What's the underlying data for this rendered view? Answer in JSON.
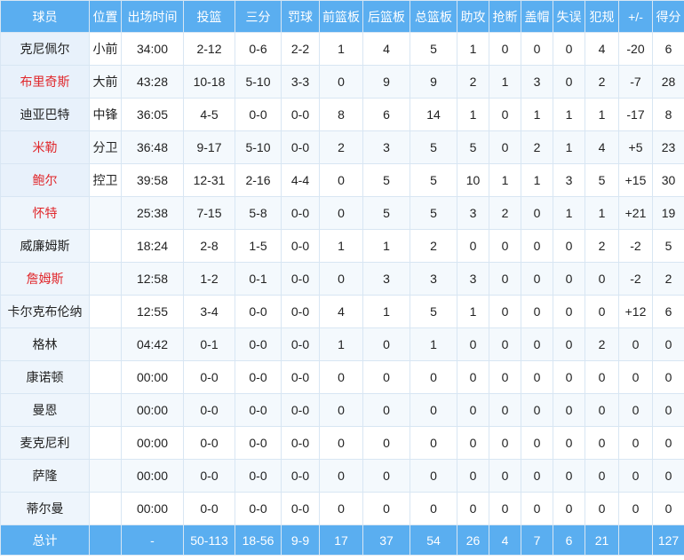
{
  "headers": [
    "球员",
    "位置",
    "出场时间",
    "投篮",
    "三分",
    "罚球",
    "前篮板",
    "后篮板",
    "总篮板",
    "助攻",
    "抢断",
    "盖帽",
    "失误",
    "犯规",
    "+/-",
    "得分"
  ],
  "players": [
    {
      "name": "克尼佩尔",
      "pos": "小前",
      "min": "34:00",
      "fg": "2-12",
      "tp": "0-6",
      "ft": "2-2",
      "oreb": "1",
      "dreb": "4",
      "reb": "5",
      "ast": "1",
      "stl": "0",
      "blk": "0",
      "tov": "0",
      "pf": "4",
      "pm": "-20",
      "pts": "6",
      "highlight": false
    },
    {
      "name": "布里奇斯",
      "pos": "大前",
      "min": "43:28",
      "fg": "10-18",
      "tp": "5-10",
      "ft": "3-3",
      "oreb": "0",
      "dreb": "9",
      "reb": "9",
      "ast": "2",
      "stl": "1",
      "blk": "3",
      "tov": "0",
      "pf": "2",
      "pm": "-7",
      "pts": "28",
      "highlight": true
    },
    {
      "name": "迪亚巴特",
      "pos": "中锋",
      "min": "36:05",
      "fg": "4-5",
      "tp": "0-0",
      "ft": "0-0",
      "oreb": "8",
      "dreb": "6",
      "reb": "14",
      "ast": "1",
      "stl": "0",
      "blk": "1",
      "tov": "1",
      "pf": "1",
      "pm": "-17",
      "pts": "8",
      "highlight": false
    },
    {
      "name": "米勒",
      "pos": "分卫",
      "min": "36:48",
      "fg": "9-17",
      "tp": "5-10",
      "ft": "0-0",
      "oreb": "2",
      "dreb": "3",
      "reb": "5",
      "ast": "5",
      "stl": "0",
      "blk": "2",
      "tov": "1",
      "pf": "4",
      "pm": "+5",
      "pts": "23",
      "highlight": true
    },
    {
      "name": "鲍尔",
      "pos": "控卫",
      "min": "39:58",
      "fg": "12-31",
      "tp": "2-16",
      "ft": "4-4",
      "oreb": "0",
      "dreb": "5",
      "reb": "5",
      "ast": "10",
      "stl": "1",
      "blk": "1",
      "tov": "3",
      "pf": "5",
      "pm": "+15",
      "pts": "30",
      "highlight": true
    },
    {
      "name": "怀特",
      "pos": "",
      "min": "25:38",
      "fg": "7-15",
      "tp": "5-8",
      "ft": "0-0",
      "oreb": "0",
      "dreb": "5",
      "reb": "5",
      "ast": "3",
      "stl": "2",
      "blk": "0",
      "tov": "1",
      "pf": "1",
      "pm": "+21",
      "pts": "19",
      "highlight": true
    },
    {
      "name": "威廉姆斯",
      "pos": "",
      "min": "18:24",
      "fg": "2-8",
      "tp": "1-5",
      "ft": "0-0",
      "oreb": "1",
      "dreb": "1",
      "reb": "2",
      "ast": "0",
      "stl": "0",
      "blk": "0",
      "tov": "0",
      "pf": "2",
      "pm": "-2",
      "pts": "5",
      "highlight": false
    },
    {
      "name": "詹姆斯",
      "pos": "",
      "min": "12:58",
      "fg": "1-2",
      "tp": "0-1",
      "ft": "0-0",
      "oreb": "0",
      "dreb": "3",
      "reb": "3",
      "ast": "3",
      "stl": "0",
      "blk": "0",
      "tov": "0",
      "pf": "0",
      "pm": "-2",
      "pts": "2",
      "highlight": true
    },
    {
      "name": "卡尔克布伦纳",
      "pos": "",
      "min": "12:55",
      "fg": "3-4",
      "tp": "0-0",
      "ft": "0-0",
      "oreb": "4",
      "dreb": "1",
      "reb": "5",
      "ast": "1",
      "stl": "0",
      "blk": "0",
      "tov": "0",
      "pf": "0",
      "pm": "+12",
      "pts": "6",
      "highlight": false
    },
    {
      "name": "格林",
      "pos": "",
      "min": "04:42",
      "fg": "0-1",
      "tp": "0-0",
      "ft": "0-0",
      "oreb": "1",
      "dreb": "0",
      "reb": "1",
      "ast": "0",
      "stl": "0",
      "blk": "0",
      "tov": "0",
      "pf": "2",
      "pm": "0",
      "pts": "0",
      "highlight": false
    },
    {
      "name": "康诺顿",
      "pos": "",
      "min": "00:00",
      "fg": "0-0",
      "tp": "0-0",
      "ft": "0-0",
      "oreb": "0",
      "dreb": "0",
      "reb": "0",
      "ast": "0",
      "stl": "0",
      "blk": "0",
      "tov": "0",
      "pf": "0",
      "pm": "0",
      "pts": "0",
      "highlight": false
    },
    {
      "name": "曼恩",
      "pos": "",
      "min": "00:00",
      "fg": "0-0",
      "tp": "0-0",
      "ft": "0-0",
      "oreb": "0",
      "dreb": "0",
      "reb": "0",
      "ast": "0",
      "stl": "0",
      "blk": "0",
      "tov": "0",
      "pf": "0",
      "pm": "0",
      "pts": "0",
      "highlight": false
    },
    {
      "name": "麦克尼利",
      "pos": "",
      "min": "00:00",
      "fg": "0-0",
      "tp": "0-0",
      "ft": "0-0",
      "oreb": "0",
      "dreb": "0",
      "reb": "0",
      "ast": "0",
      "stl": "0",
      "blk": "0",
      "tov": "0",
      "pf": "0",
      "pm": "0",
      "pts": "0",
      "highlight": false
    },
    {
      "name": "萨隆",
      "pos": "",
      "min": "00:00",
      "fg": "0-0",
      "tp": "0-0",
      "ft": "0-0",
      "oreb": "0",
      "dreb": "0",
      "reb": "0",
      "ast": "0",
      "stl": "0",
      "blk": "0",
      "tov": "0",
      "pf": "0",
      "pm": "0",
      "pts": "0",
      "highlight": false
    },
    {
      "name": "蒂尔曼",
      "pos": "",
      "min": "00:00",
      "fg": "0-0",
      "tp": "0-0",
      "ft": "0-0",
      "oreb": "0",
      "dreb": "0",
      "reb": "0",
      "ast": "0",
      "stl": "0",
      "blk": "0",
      "tov": "0",
      "pf": "0",
      "pm": "0",
      "pts": "0",
      "highlight": false
    }
  ],
  "totals": {
    "name": "总计",
    "pos": "",
    "min": "-",
    "fg": "50-113",
    "tp": "18-56",
    "ft": "9-9",
    "oreb": "17",
    "dreb": "37",
    "reb": "54",
    "ast": "26",
    "stl": "4",
    "blk": "7",
    "tov": "6",
    "pf": "21",
    "pm": "",
    "pts": "127"
  },
  "colors": {
    "header_bg": "#5aaef0",
    "header_text": "#ffffff",
    "highlight_name": "#e0272b",
    "row_alt": "#f4f9fd",
    "name_bg": "#eef5fc"
  }
}
